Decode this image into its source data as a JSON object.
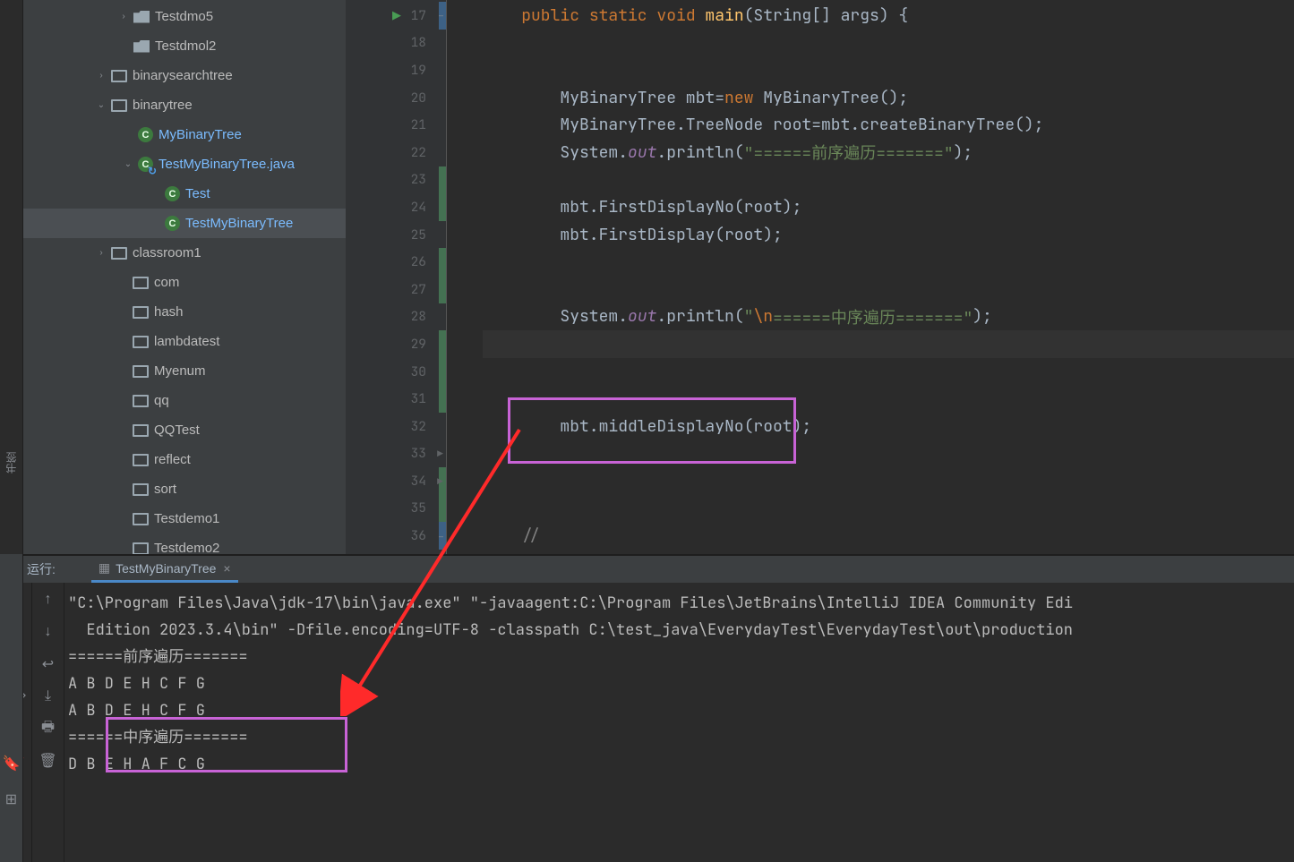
{
  "leftbar": {
    "bookmarks": "书签"
  },
  "tree": {
    "items": [
      {
        "indent": 105,
        "chev": "›",
        "icon": "folder",
        "label": "Testdmo5"
      },
      {
        "indent": 105,
        "chev": "",
        "icon": "folder",
        "label": "Testdmol2"
      },
      {
        "indent": 80,
        "chev": "›",
        "icon": "pkg",
        "label": "binarysearchtree"
      },
      {
        "indent": 80,
        "chev": "⌄",
        "icon": "pkg",
        "label": "binarytree"
      },
      {
        "indent": 110,
        "chev": "",
        "icon": "class",
        "glyph": "C",
        "label": "MyBinaryTree",
        "hl": true
      },
      {
        "indent": 110,
        "chev": "⌄",
        "icon": "java",
        "glyph": "C",
        "label": "TestMyBinaryTree.java",
        "hl": true
      },
      {
        "indent": 140,
        "chev": "",
        "icon": "class",
        "glyph": "C",
        "label": "Test",
        "hl": true
      },
      {
        "indent": 140,
        "chev": "",
        "icon": "class",
        "glyph": "C",
        "label": "TestMyBinaryTree",
        "hl": true,
        "selected": true
      },
      {
        "indent": 80,
        "chev": "›",
        "icon": "pkg",
        "label": "classroom1"
      },
      {
        "indent": 104,
        "chev": "",
        "icon": "pkg",
        "label": "com"
      },
      {
        "indent": 104,
        "chev": "",
        "icon": "pkg",
        "label": "hash"
      },
      {
        "indent": 104,
        "chev": "",
        "icon": "pkg",
        "label": "lambdatest"
      },
      {
        "indent": 104,
        "chev": "",
        "icon": "pkg",
        "label": "Myenum"
      },
      {
        "indent": 104,
        "chev": "",
        "icon": "pkg",
        "label": "qq"
      },
      {
        "indent": 104,
        "chev": "",
        "icon": "pkg",
        "label": "QQTest"
      },
      {
        "indent": 104,
        "chev": "",
        "icon": "pkg",
        "label": "reflect"
      },
      {
        "indent": 104,
        "chev": "",
        "icon": "pkg",
        "label": "sort"
      },
      {
        "indent": 104,
        "chev": "",
        "icon": "pkg",
        "label": "Testdemo1"
      },
      {
        "indent": 104,
        "chev": "",
        "icon": "pkg",
        "label": "Testdemo2"
      }
    ]
  },
  "editor": {
    "lines": [
      {
        "num": 17,
        "run": true,
        "vcs": "mod",
        "fold": "⊟",
        "tok": [
          [
            "kw",
            "public "
          ],
          [
            "kw",
            "static "
          ],
          [
            "kw",
            "void "
          ],
          [
            "fn",
            "main"
          ],
          [
            "cls",
            "(String[] args) {"
          ]
        ]
      },
      {
        "num": 18,
        "tok": []
      },
      {
        "num": 19,
        "tok": []
      },
      {
        "num": 20,
        "indent": 1,
        "tok": [
          [
            "cls",
            "MyBinaryTree mbt="
          ],
          [
            "kw",
            "new "
          ],
          [
            "cls",
            "MyBinaryTree();"
          ]
        ]
      },
      {
        "num": 21,
        "indent": 1,
        "tok": [
          [
            "cls",
            "MyBinaryTree.TreeNode root=mbt.createBinaryTree();"
          ]
        ]
      },
      {
        "num": 22,
        "indent": 1,
        "tok": [
          [
            "cls",
            "System."
          ],
          [
            "field",
            "out"
          ],
          [
            "cls",
            ".println("
          ],
          [
            "str",
            "\"======前序遍历=======\""
          ],
          [
            "cls",
            ");"
          ]
        ]
      },
      {
        "num": 23,
        "vcs": "add",
        "tok": []
      },
      {
        "num": 24,
        "vcs": "add",
        "indent": 1,
        "tok": [
          [
            "cls",
            "mbt.FirstDisplayNo(root);"
          ]
        ]
      },
      {
        "num": 25,
        "indent": 1,
        "tok": [
          [
            "cls",
            "mbt.FirstDisplay(root);"
          ]
        ]
      },
      {
        "num": 26,
        "vcs": "add",
        "tok": []
      },
      {
        "num": 27,
        "vcs": "add",
        "tok": []
      },
      {
        "num": 28,
        "indent": 1,
        "tok": [
          [
            "cls",
            "System."
          ],
          [
            "field",
            "out"
          ],
          [
            "cls",
            ".println("
          ],
          [
            "str",
            "\""
          ],
          [
            "esc",
            "\\n"
          ],
          [
            "str",
            "======中序遍历=======\""
          ],
          [
            "cls",
            ");"
          ]
        ]
      },
      {
        "num": 29,
        "vcs": "add",
        "current": true,
        "tok": []
      },
      {
        "num": 30,
        "vcs": "add",
        "tok": []
      },
      {
        "num": 31,
        "vcs": "add",
        "tok": []
      },
      {
        "num": 32,
        "indent": 1,
        "tok": [
          [
            "cls",
            "mbt.middleDisplayNo(root);"
          ]
        ]
      },
      {
        "num": 33,
        "expand": true,
        "tok": []
      },
      {
        "num": 34,
        "vcs": "add",
        "expand": true,
        "tok": []
      },
      {
        "num": 35,
        "vcs": "add",
        "tok": []
      },
      {
        "num": 36,
        "vcs": "mod",
        "fold": "⊟",
        "tok": [
          [
            "cmt",
            "//"
          ]
        ]
      }
    ]
  },
  "run": {
    "label": "运行:",
    "tab": "TestMyBinaryTree",
    "console": [
      "\"C:\\Program Files\\Java\\jdk-17\\bin\\java.exe\" \"-javaagent:C:\\Program Files\\JetBrains\\IntelliJ IDEA Community Edi",
      "  Edition 2023.3.4\\bin\" -Dfile.encoding=UTF-8 -classpath C:\\test_java\\EverydayTest\\EverydayTest\\out\\production",
      "======前序遍历=======",
      "A B D E H C F G ",
      "A B D E H C F G ",
      "======中序遍历=======",
      "D B E H A F C G "
    ]
  }
}
